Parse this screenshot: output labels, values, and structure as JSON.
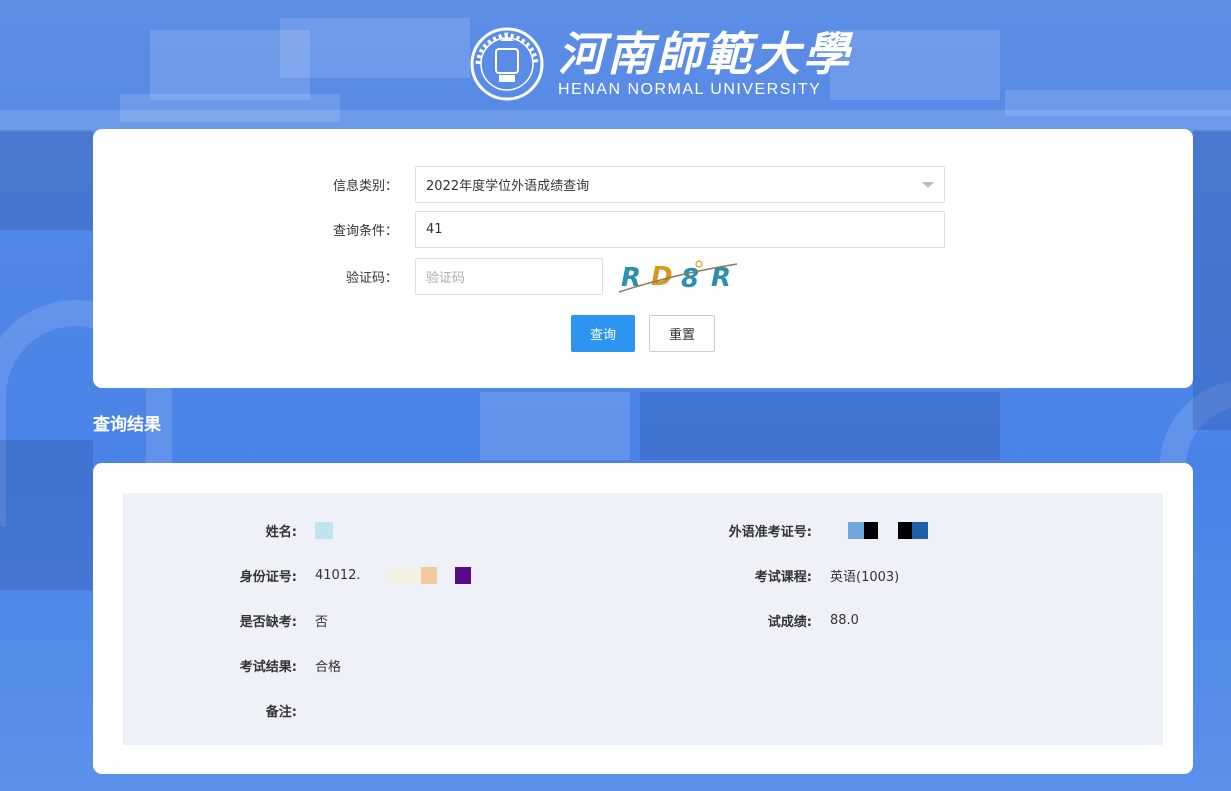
{
  "header": {
    "school_name_cn": "河南師範大學",
    "school_name_en": "HENAN NORMAL UNIVERSITY",
    "seal_text": "河南师范大学"
  },
  "form": {
    "category_label": "信息类别：",
    "category_value": "2022年度学位外语成绩查询",
    "condition_label": "查询条件：",
    "condition_value": "41",
    "captcha_label": "验证码：",
    "captcha_placeholder": "验证码",
    "captcha_text": "RD8R",
    "search_button": "查询",
    "reset_button": "重置"
  },
  "results": {
    "section_title": "查询结果",
    "fields": {
      "name_label": "姓名:",
      "name_value": "",
      "admission_label": "外语准考证号:",
      "admission_value": "",
      "id_label": "身份证号:",
      "id_value": "41012.",
      "course_label": "考试课程:",
      "course_value": "英语(1003)",
      "absent_label": "是否缺考:",
      "absent_value": "否",
      "score_label": "试成绩:",
      "score_value": "88.0",
      "result_label": "考试结果:",
      "result_value": "合格",
      "remark_label": "备注:",
      "remark_value": ""
    }
  },
  "colors": {
    "background": "#4f86e6",
    "primary_button": "#2d95f0",
    "panel": "#eef1f7"
  }
}
